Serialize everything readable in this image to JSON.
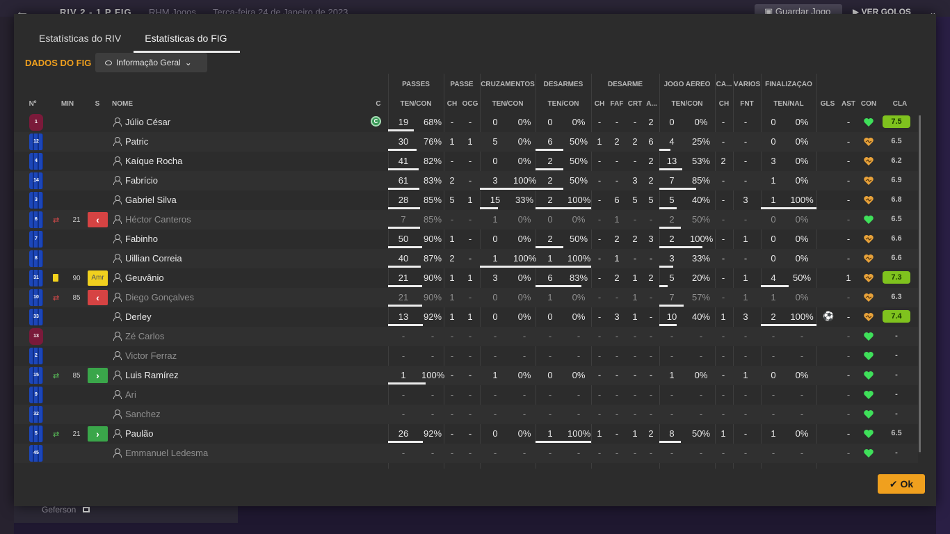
{
  "background": {
    "score": "RIV 2 - 1 P FIG",
    "club": "RHM Jogos",
    "date": "Terça-feira 24 de Janeiro de 2023",
    "save_label": "Guardar Jogo",
    "goals_label": "VER GOLOS",
    "bottom_player": "Geferson"
  },
  "tabs": [
    {
      "label": "Estatísticas do RIV",
      "active": false
    },
    {
      "label": "Estatísticas do FIG",
      "active": true
    }
  ],
  "section_title": "DADOS DO FIG",
  "dropdown_label": "Informação Geral",
  "group_headers": {
    "passes": "PASSES",
    "passe": "PASSE",
    "cruz": "CRUZAMENTOS",
    "des": "DESARMES",
    "desarme": "DESARME",
    "aereo": "JOGO AÉREO",
    "ca": "CA...",
    "varios": "VÁRIOS",
    "final": "FINALIZAÇÃO"
  },
  "col_headers": {
    "num": "Nº",
    "min": "MIN",
    "s": "S",
    "nome": "NOME",
    "c": "C",
    "passes": "TEN/CON",
    "ch": "CH",
    "ocg": "OCG",
    "cruz": "TEN/CON",
    "des": "TEN/CON",
    "dch": "CH",
    "faf": "FAF",
    "crt": "CRT",
    "a": "A...",
    "aereo": "TEN/CON",
    "cach": "CH",
    "fnt": "FNT",
    "final": "TEN/NAL",
    "gls": "GLS",
    "ast": "AST",
    "con": "CON",
    "cla": "CLA"
  },
  "ok_label": "Ok",
  "colors": {
    "accent": "#f0a01e",
    "rating_good": "#7fc21e",
    "heart_green": "#3fe05a",
    "heart_orange": "#e8a23a"
  },
  "rows": [
    {
      "num": "1",
      "kit": "gk",
      "min": "",
      "sub": "",
      "s": "",
      "name": "Júlio César",
      "cap": "C",
      "dim": false,
      "p1": "19",
      "p2": "68%",
      "pb": 0.68,
      "ch": "-",
      "ocg": "-",
      "c1": "0",
      "c2": "0%",
      "cb": 0,
      "d1": "0",
      "d2": "0%",
      "db": 0,
      "dch": "-",
      "faf": "-",
      "crt": "-",
      "a": "2",
      "a1": "0",
      "a2": "0%",
      "ab": 0,
      "cach": "-",
      "fnt": "-",
      "f1": "0",
      "f2": "0%",
      "fb": 0,
      "gls": "",
      "ast": "-",
      "heart": "green",
      "cla": "7.5",
      "good": true
    },
    {
      "num": "12",
      "kit": "blue",
      "min": "",
      "sub": "",
      "s": "",
      "name": "Patric",
      "cap": "",
      "dim": false,
      "p1": "30",
      "p2": "76%",
      "pb": 0.76,
      "ch": "1",
      "ocg": "1",
      "c1": "5",
      "c2": "0%",
      "cb": 0,
      "d1": "6",
      "d2": "50%",
      "db": 0.5,
      "dch": "1",
      "faf": "2",
      "crt": "2",
      "a": "6",
      "a1": "4",
      "a2": "25%",
      "ab": 0.25,
      "cach": "-",
      "fnt": "-",
      "f1": "0",
      "f2": "0%",
      "fb": 0,
      "gls": "",
      "ast": "-",
      "heart": "orange",
      "cla": "6.5",
      "good": false
    },
    {
      "num": "4",
      "kit": "blue",
      "min": "",
      "sub": "",
      "s": "",
      "name": "Kaíque Rocha",
      "cap": "",
      "dim": false,
      "p1": "41",
      "p2": "82%",
      "pb": 0.82,
      "ch": "-",
      "ocg": "-",
      "c1": "0",
      "c2": "0%",
      "cb": 0,
      "d1": "2",
      "d2": "50%",
      "db": 0.5,
      "dch": "-",
      "faf": "-",
      "crt": "-",
      "a": "2",
      "a1": "13",
      "a2": "53%",
      "ab": 0.53,
      "cach": "2",
      "fnt": "-",
      "f1": "3",
      "f2": "0%",
      "fb": 0,
      "gls": "",
      "ast": "-",
      "heart": "orange",
      "cla": "6.2",
      "good": false
    },
    {
      "num": "14",
      "kit": "blue",
      "min": "",
      "sub": "",
      "s": "",
      "name": "Fabrício",
      "cap": "",
      "dim": false,
      "p1": "61",
      "p2": "83%",
      "pb": 0.83,
      "ch": "2",
      "ocg": "-",
      "c1": "3",
      "c2": "100%",
      "cb": 1,
      "d1": "2",
      "d2": "50%",
      "db": 0.5,
      "dch": "-",
      "faf": "-",
      "crt": "3",
      "a": "2",
      "a1": "7",
      "a2": "85%",
      "ab": 0.85,
      "cach": "-",
      "fnt": "-",
      "f1": "1",
      "f2": "0%",
      "fb": 0,
      "gls": "",
      "ast": "-",
      "heart": "orange",
      "cla": "6.9",
      "good": false
    },
    {
      "num": "3",
      "kit": "blue",
      "min": "",
      "sub": "",
      "s": "",
      "name": "Gabriel Silva",
      "cap": "",
      "dim": false,
      "p1": "28",
      "p2": "85%",
      "pb": 0.85,
      "ch": "5",
      "ocg": "1",
      "c1": "15",
      "c2": "33%",
      "cb": 0.33,
      "d1": "2",
      "d2": "100%",
      "db": 1,
      "dch": "-",
      "faf": "6",
      "crt": "5",
      "a": "5",
      "a1": "5",
      "a2": "40%",
      "ab": 0.4,
      "cach": "-",
      "fnt": "3",
      "f1": "1",
      "f2": "100%",
      "fb": 1,
      "gls": "",
      "ast": "-",
      "heart": "orange",
      "cla": "6.8",
      "good": false
    },
    {
      "num": "6",
      "kit": "blue",
      "min": "21",
      "sub": "out",
      "s": "red",
      "name": "Héctor Canteros",
      "cap": "",
      "dim": true,
      "p1": "7",
      "p2": "85%",
      "pb": 0.85,
      "ch": "-",
      "ocg": "-",
      "c1": "1",
      "c2": "0%",
      "cb": 0,
      "d1": "0",
      "d2": "0%",
      "db": 0,
      "dch": "-",
      "faf": "1",
      "crt": "-",
      "a": "-",
      "a1": "2",
      "a2": "50%",
      "ab": 0.5,
      "cach": "-",
      "fnt": "-",
      "f1": "0",
      "f2": "0%",
      "fb": 0,
      "gls": "",
      "ast": "-",
      "heart": "green",
      "cla": "6.5",
      "good": false
    },
    {
      "num": "7",
      "kit": "blue",
      "min": "",
      "sub": "",
      "s": "",
      "name": "Fabinho",
      "cap": "",
      "dim": false,
      "p1": "50",
      "p2": "90%",
      "pb": 0.9,
      "ch": "1",
      "ocg": "-",
      "c1": "0",
      "c2": "0%",
      "cb": 0,
      "d1": "2",
      "d2": "50%",
      "db": 0.5,
      "dch": "-",
      "faf": "2",
      "crt": "2",
      "a": "3",
      "a1": "2",
      "a2": "100%",
      "ab": 1,
      "cach": "-",
      "fnt": "1",
      "f1": "0",
      "f2": "0%",
      "fb": 0,
      "gls": "",
      "ast": "-",
      "heart": "orange",
      "cla": "6.6",
      "good": false
    },
    {
      "num": "8",
      "kit": "blue",
      "min": "",
      "sub": "",
      "s": "",
      "name": "Uillian Correia",
      "cap": "",
      "dim": false,
      "p1": "40",
      "p2": "87%",
      "pb": 0.87,
      "ch": "2",
      "ocg": "-",
      "c1": "1",
      "c2": "100%",
      "cb": 1,
      "d1": "1",
      "d2": "100%",
      "db": 1,
      "dch": "-",
      "faf": "1",
      "crt": "-",
      "a": "-",
      "a1": "3",
      "a2": "33%",
      "ab": 0.33,
      "cach": "-",
      "fnt": "-",
      "f1": "0",
      "f2": "0%",
      "fb": 0,
      "gls": "",
      "ast": "-",
      "heart": "orange",
      "cla": "6.6",
      "good": false
    },
    {
      "num": "31",
      "kit": "blue",
      "min": "90",
      "sub": "yellow",
      "s": "yellow",
      "s_label": "Amr",
      "name": "Geuvânio",
      "cap": "",
      "dim": false,
      "p1": "21",
      "p2": "90%",
      "pb": 0.9,
      "ch": "1",
      "ocg": "1",
      "c1": "3",
      "c2": "0%",
      "cb": 0,
      "d1": "6",
      "d2": "83%",
      "db": 0.83,
      "dch": "-",
      "faf": "2",
      "crt": "1",
      "a": "2",
      "a1": "5",
      "a2": "20%",
      "ab": 0.2,
      "cach": "-",
      "fnt": "1",
      "f1": "4",
      "f2": "50%",
      "fb": 0.5,
      "gls": "",
      "ast": "1",
      "heart": "orange",
      "cla": "7.3",
      "good": true
    },
    {
      "num": "10",
      "kit": "blue",
      "min": "85",
      "sub": "out",
      "s": "red",
      "name": "Diego Gonçalves",
      "cap": "",
      "dim": true,
      "p1": "21",
      "p2": "90%",
      "pb": 0.9,
      "ch": "1",
      "ocg": "-",
      "c1": "0",
      "c2": "0%",
      "cb": 0,
      "d1": "1",
      "d2": "0%",
      "db": 0,
      "dch": "-",
      "faf": "-",
      "crt": "1",
      "a": "-",
      "a1": "7",
      "a2": "57%",
      "ab": 0.57,
      "cach": "-",
      "fnt": "1",
      "f1": "1",
      "f2": "0%",
      "fb": 0,
      "gls": "",
      "ast": "-",
      "heart": "orange",
      "cla": "6.3",
      "good": false
    },
    {
      "num": "33",
      "kit": "blue",
      "min": "",
      "sub": "",
      "s": "",
      "name": "Derley",
      "cap": "",
      "dim": false,
      "p1": "13",
      "p2": "92%",
      "pb": 0.92,
      "ch": "1",
      "ocg": "1",
      "c1": "0",
      "c2": "0%",
      "cb": 0,
      "d1": "0",
      "d2": "0%",
      "db": 0,
      "dch": "-",
      "faf": "3",
      "crt": "1",
      "a": "-",
      "a1": "10",
      "a2": "40%",
      "ab": 0.4,
      "cach": "1",
      "fnt": "3",
      "f1": "2",
      "f2": "100%",
      "fb": 1,
      "gls": "ball",
      "ast": "-",
      "heart": "orange",
      "cla": "7.4",
      "good": true
    },
    {
      "num": "13",
      "kit": "gk",
      "min": "",
      "sub": "",
      "s": "",
      "name": "Zé Carlos",
      "cap": "",
      "dim": true,
      "p1": "-",
      "p2": "-",
      "pb": -1,
      "ch": "-",
      "ocg": "-",
      "c1": "-",
      "c2": "-",
      "cb": -1,
      "d1": "-",
      "d2": "-",
      "db": -1,
      "dch": "-",
      "faf": "-",
      "crt": "-",
      "a": "-",
      "a1": "-",
      "a2": "-",
      "ab": -1,
      "cach": "-",
      "fnt": "-",
      "f1": "-",
      "f2": "-",
      "fb": -1,
      "gls": "",
      "ast": "-",
      "heart": "green",
      "cla": "-",
      "good": false
    },
    {
      "num": "2",
      "kit": "blue",
      "min": "",
      "sub": "",
      "s": "",
      "name": "Victor Ferraz",
      "cap": "",
      "dim": true,
      "p1": "-",
      "p2": "-",
      "pb": -1,
      "ch": "-",
      "ocg": "-",
      "c1": "-",
      "c2": "-",
      "cb": -1,
      "d1": "-",
      "d2": "-",
      "db": -1,
      "dch": "-",
      "faf": "-",
      "crt": "-",
      "a": "-",
      "a1": "-",
      "a2": "-",
      "ab": -1,
      "cach": "-",
      "fnt": "-",
      "f1": "-",
      "f2": "-",
      "fb": -1,
      "gls": "",
      "ast": "-",
      "heart": "green",
      "cla": "-",
      "good": false
    },
    {
      "num": "15",
      "kit": "blue",
      "min": "85",
      "sub": "in",
      "s": "green",
      "name": "Luis Ramírez",
      "cap": "",
      "dim": false,
      "p1": "1",
      "p2": "100%",
      "pb": 1,
      "ch": "-",
      "ocg": "-",
      "c1": "1",
      "c2": "0%",
      "cb": 0,
      "d1": "0",
      "d2": "0%",
      "db": 0,
      "dch": "-",
      "faf": "-",
      "crt": "-",
      "a": "-",
      "a1": "1",
      "a2": "0%",
      "ab": 0,
      "cach": "-",
      "fnt": "1",
      "f1": "0",
      "f2": "0%",
      "fb": 0,
      "gls": "",
      "ast": "-",
      "heart": "green",
      "cla": "-",
      "good": false
    },
    {
      "num": "9",
      "kit": "blue",
      "min": "",
      "sub": "",
      "s": "",
      "name": "Ari",
      "cap": "",
      "dim": true,
      "p1": "-",
      "p2": "-",
      "pb": -1,
      "ch": "-",
      "ocg": "-",
      "c1": "-",
      "c2": "-",
      "cb": -1,
      "d1": "-",
      "d2": "-",
      "db": -1,
      "dch": "-",
      "faf": "-",
      "crt": "-",
      "a": "-",
      "a1": "-",
      "a2": "-",
      "ab": -1,
      "cach": "-",
      "fnt": "-",
      "f1": "-",
      "f2": "-",
      "fb": -1,
      "gls": "",
      "ast": "-",
      "heart": "green",
      "cla": "-",
      "good": false
    },
    {
      "num": "32",
      "kit": "blue",
      "min": "",
      "sub": "",
      "s": "",
      "name": "Sanchez",
      "cap": "",
      "dim": true,
      "p1": "-",
      "p2": "-",
      "pb": -1,
      "ch": "-",
      "ocg": "-",
      "c1": "-",
      "c2": "-",
      "cb": -1,
      "d1": "-",
      "d2": "-",
      "db": -1,
      "dch": "-",
      "faf": "-",
      "crt": "-",
      "a": "-",
      "a1": "-",
      "a2": "-",
      "ab": -1,
      "cach": "-",
      "fnt": "-",
      "f1": "-",
      "f2": "-",
      "fb": -1,
      "gls": "",
      "ast": "-",
      "heart": "green",
      "cla": "-",
      "good": false
    },
    {
      "num": "5",
      "kit": "blue",
      "min": "21",
      "sub": "in",
      "s": "green",
      "name": "Paulão",
      "cap": "",
      "dim": false,
      "p1": "26",
      "p2": "92%",
      "pb": 0.92,
      "ch": "-",
      "ocg": "-",
      "c1": "0",
      "c2": "0%",
      "cb": 0,
      "d1": "1",
      "d2": "100%",
      "db": 1,
      "dch": "1",
      "faf": "-",
      "crt": "1",
      "a": "2",
      "a1": "8",
      "a2": "50%",
      "ab": 0.5,
      "cach": "1",
      "fnt": "-",
      "f1": "1",
      "f2": "0%",
      "fb": 0,
      "gls": "",
      "ast": "-",
      "heart": "green",
      "cla": "6.5",
      "good": false
    },
    {
      "num": "45",
      "kit": "blue",
      "min": "",
      "sub": "",
      "s": "",
      "name": "Emmanuel Ledesma",
      "cap": "",
      "dim": true,
      "p1": "-",
      "p2": "-",
      "pb": -1,
      "ch": "-",
      "ocg": "-",
      "c1": "-",
      "c2": "-",
      "cb": -1,
      "d1": "-",
      "d2": "-",
      "db": -1,
      "dch": "-",
      "faf": "-",
      "crt": "-",
      "a": "-",
      "a1": "-",
      "a2": "-",
      "ab": -1,
      "cach": "-",
      "fnt": "-",
      "f1": "-",
      "f2": "-",
      "fb": -1,
      "gls": "",
      "ast": "-",
      "heart": "green",
      "cla": "-",
      "good": false
    }
  ]
}
